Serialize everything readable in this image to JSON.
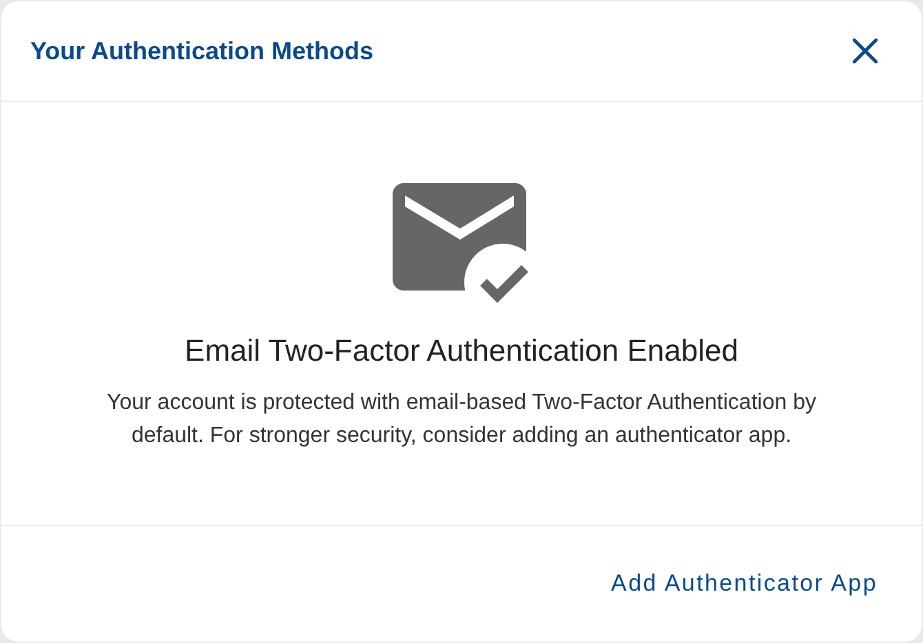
{
  "dialog": {
    "title": "Your Authentication Methods"
  },
  "status": {
    "heading": "Email Two-Factor Authentication Enabled",
    "description": "Your account is protected with email-based Two-Factor Authentication by default. For stronger security, consider adding an authenticator app."
  },
  "footer": {
    "action": "Add Authenticator App"
  }
}
